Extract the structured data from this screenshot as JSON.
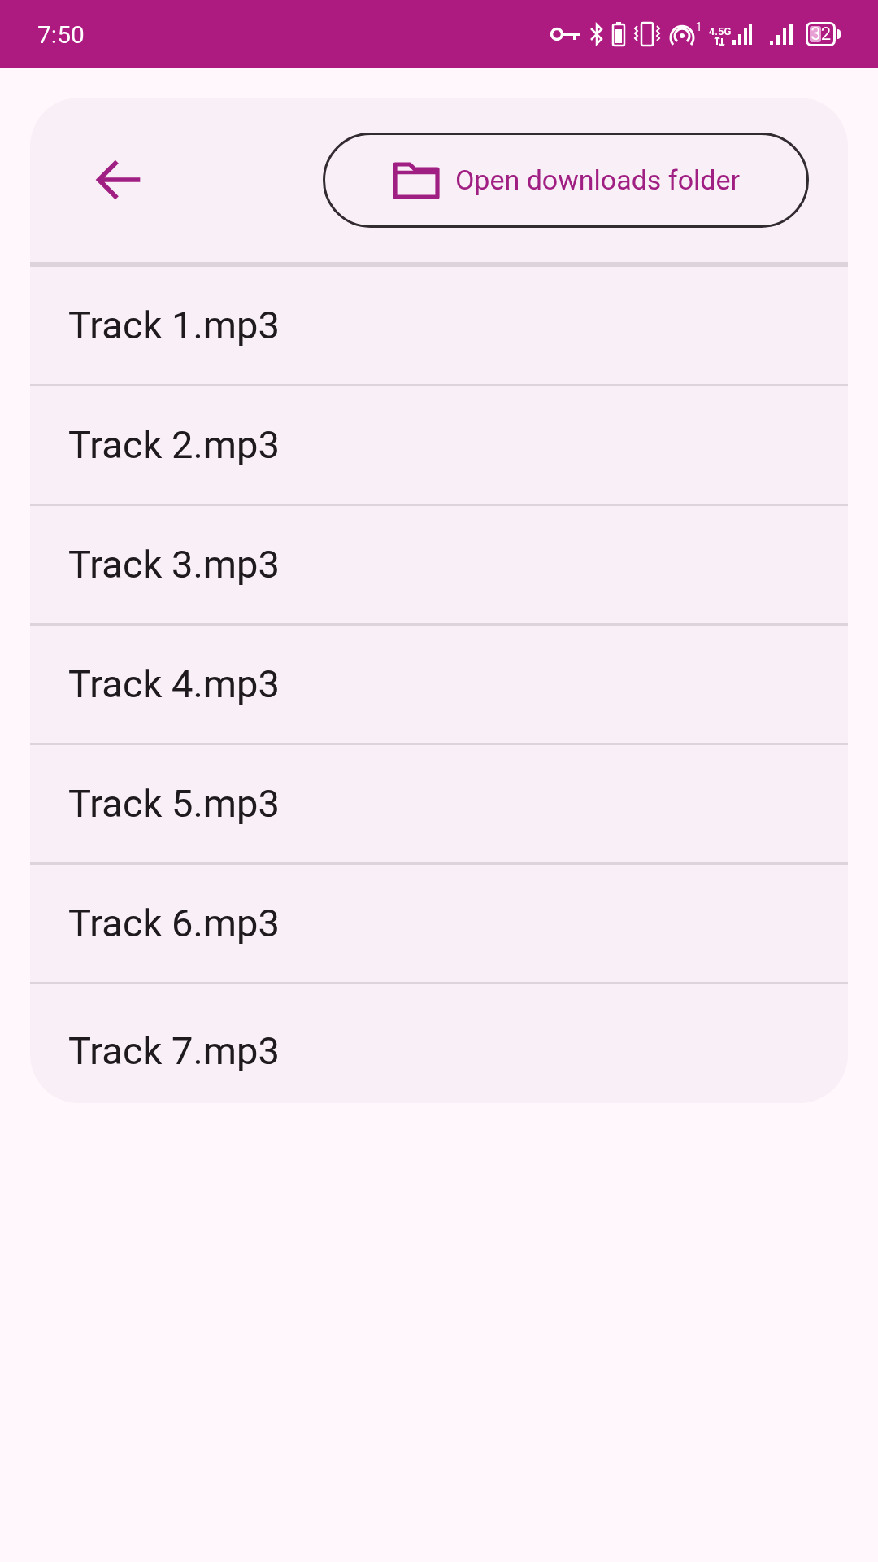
{
  "status_bar": {
    "time": "7:50",
    "hotspot_count": "1",
    "network": "4.5G",
    "battery": "32"
  },
  "header": {
    "open_folder_button": "Open downloads folder"
  },
  "files": [
    {
      "name": "Track 1.mp3"
    },
    {
      "name": "Track 2.mp3"
    },
    {
      "name": "Track 3.mp3"
    },
    {
      "name": "Track 4.mp3"
    },
    {
      "name": "Track 5.mp3"
    },
    {
      "name": "Track 6.mp3"
    },
    {
      "name": "Track 7.mp3"
    }
  ]
}
